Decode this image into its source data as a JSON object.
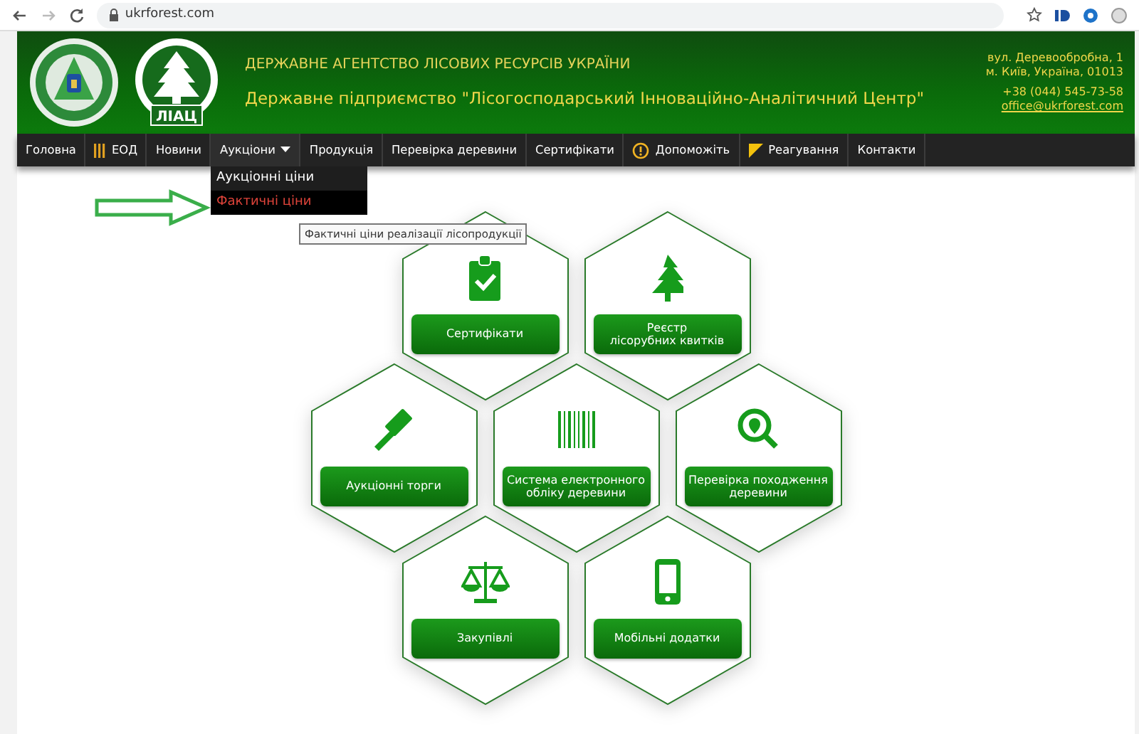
{
  "browser": {
    "url": "ukrforest.com"
  },
  "header": {
    "title": "ДЕРЖАВНЕ АГЕНТСТВО ЛІСОВИХ РЕСУРСІВ УКРАЇНИ",
    "subtitle": "Державне підприємство \"Лісогосподарський Інноваційно-Аналітичний Центр\"",
    "logo_text": "ЛІАЦ",
    "address": [
      "вул. Деревообробна, 1",
      "м. Київ, Україна, 01013"
    ],
    "phone": "+38 (044) 545-73-58",
    "email": "office@ukrforest.com"
  },
  "nav": [
    {
      "label": "Головна",
      "kind": "plain"
    },
    {
      "label": "ЕОД",
      "kind": "bars"
    },
    {
      "label": "Новини",
      "kind": "plain"
    },
    {
      "label": "Аукціони",
      "kind": "dropdown",
      "menu": {
        "expanded": true,
        "items": [
          {
            "label": "Аукціонні ціни",
            "selected": false
          },
          {
            "label": "Фактичні ціни",
            "selected": true
          }
        ]
      }
    },
    {
      "label": "Продукція",
      "kind": "plain"
    },
    {
      "label": "Перевірка деревини",
      "kind": "plain"
    },
    {
      "label": "Сертифікати",
      "kind": "plain"
    },
    {
      "label": "Допоможіть",
      "kind": "alert"
    },
    {
      "label": "Реагування",
      "kind": "flag"
    },
    {
      "label": "Контакти",
      "kind": "plain"
    }
  ],
  "tooltip": "Фактичні ціни реалізації лісопродукції",
  "tiles": [
    [
      {
        "label": "Сертифікати"
      },
      {
        "label": "Реєстр\nлісорубних квитків"
      }
    ],
    [
      {
        "label": "Аукціонні торги"
      },
      {
        "label": "Система електронного обліку деревини"
      },
      {
        "label": "Перевірка походження деревини"
      }
    ],
    [
      {
        "label": "Закупівлі"
      },
      {
        "label": "Мобільні додатки"
      }
    ]
  ]
}
